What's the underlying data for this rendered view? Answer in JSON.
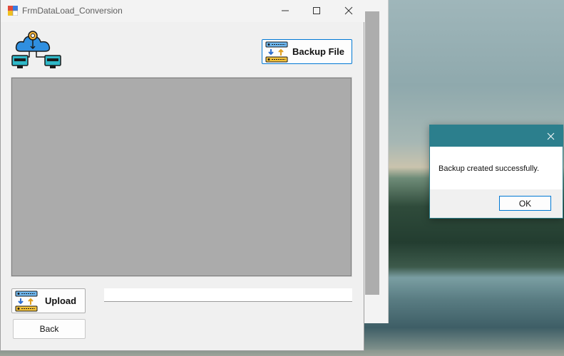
{
  "window": {
    "title": "FrmDataLoad_Conversion",
    "minimize_icon": "minimize-icon",
    "maximize_icon": "maximize-icon",
    "close_icon": "close-icon"
  },
  "toolbar": {
    "logo_icon": "cloud-network-icon",
    "backup_label": "Backup File",
    "backup_icon": "file-transfer-icon"
  },
  "footer": {
    "upload_label": "Upload",
    "upload_icon": "file-transfer-icon",
    "back_label": "Back",
    "progress": 0
  },
  "dialog": {
    "message": "Backup created successfully.",
    "ok_label": "OK",
    "close_icon": "close-icon"
  },
  "colors": {
    "dialog_accent": "#2c7f8d",
    "focus_border": "#0078d4",
    "panel_gray": "#ababab"
  }
}
